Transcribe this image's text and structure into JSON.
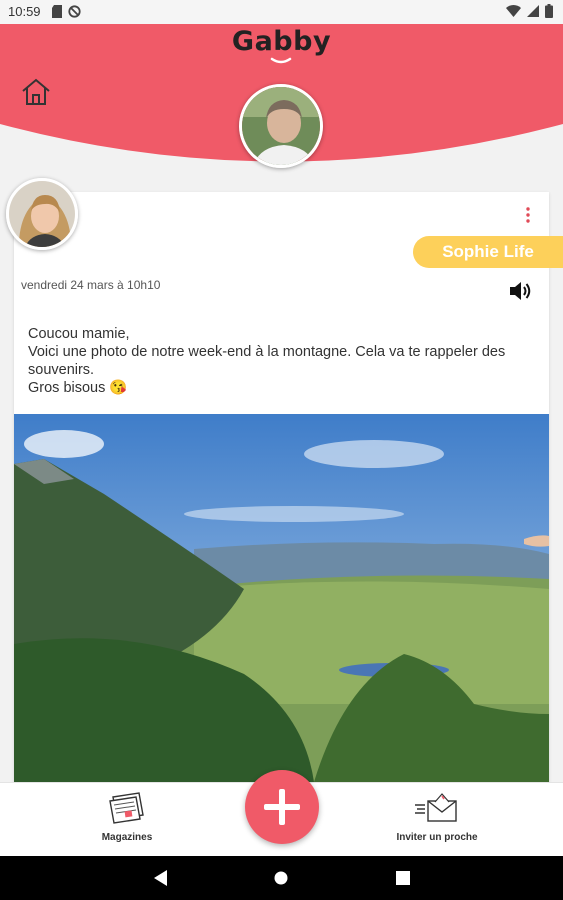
{
  "status_bar": {
    "time": "10:59",
    "left_icons": [
      "sd-card-icon",
      "no-signal-circle-icon"
    ],
    "right_icons": [
      "wifi-icon",
      "cell-signal-icon",
      "battery-icon"
    ]
  },
  "header": {
    "logo": "Gabby",
    "accent_color": "#f05a68",
    "home_icon": "home-icon"
  },
  "post": {
    "author": "Sophie Life",
    "date": "vendredi 24 mars à 10h10",
    "message_lines": [
      "Coucou mamie,",
      "Voici une photo de notre week-end à la montagne. Cela va te rappeler des souvenirs.",
      "Gros bisous 😘"
    ],
    "tag_color": "#fdd05a"
  },
  "bottom_nav": {
    "magazines_label": "Magazines",
    "invite_label": "Inviter un proche",
    "add_icon": "plus-icon"
  }
}
